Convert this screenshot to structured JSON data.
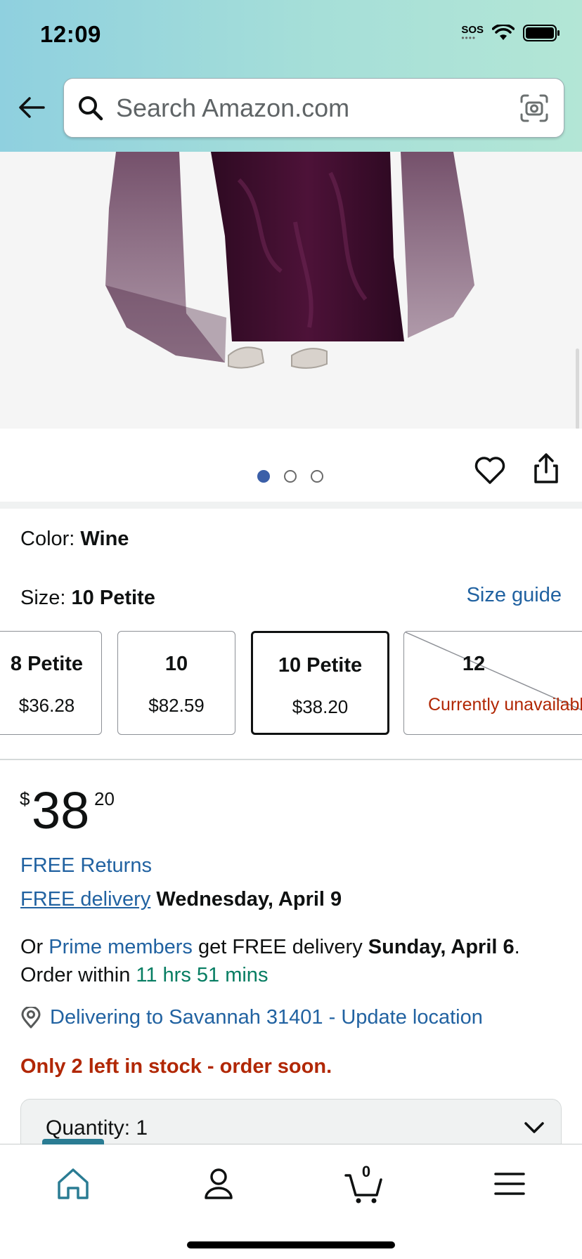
{
  "status_bar": {
    "time": "12:09",
    "sos": "SOS"
  },
  "search": {
    "placeholder": "Search Amazon.com"
  },
  "carousel": {
    "dot_count": 3,
    "active_index": 0
  },
  "product": {
    "color_label": "Color: ",
    "color_value": "Wine",
    "size_label": "Size: ",
    "size_value": "10 Petite",
    "size_guide": "Size guide",
    "sizes": [
      {
        "name": "8 Petite",
        "price": "$36.28",
        "available": true
      },
      {
        "name": "10",
        "price": "$82.59",
        "available": true
      },
      {
        "name": "10 Petite",
        "price": "$38.20",
        "available": true,
        "selected": true
      },
      {
        "name": "12",
        "status": "Currently unavailable",
        "available": false
      }
    ],
    "price_symbol": "$",
    "price_whole": "38",
    "price_fraction": "20"
  },
  "shipping": {
    "free_returns": "FREE Returns",
    "free_delivery_link": "FREE delivery",
    "free_delivery_date": "Wednesday, April 9",
    "prime_prefix": "Or ",
    "prime_link": "Prime members",
    "prime_middle": " get FREE delivery ",
    "prime_date": "Sunday, April 6",
    "prime_suffix": ".",
    "order_within_prefix": "Order within ",
    "order_within_time": "11 hrs 51 mins",
    "location": "Delivering to Savannah 31401 - Update location",
    "stock": "Only 2 left in stock - order soon."
  },
  "quantity": {
    "label": "Quantity:",
    "value": "1"
  },
  "nav": {
    "cart_count": "0"
  },
  "colors": {
    "link": "#2162a1",
    "alert": "#b12704",
    "green": "#067d62",
    "nav_accent": "#2a7c93"
  },
  "icons": [
    "back-arrow-icon",
    "search-icon",
    "camera-icon",
    "heart-icon",
    "share-icon",
    "location-pin-icon",
    "chevron-down-icon",
    "home-icon",
    "account-icon",
    "cart-icon",
    "menu-icon"
  ]
}
